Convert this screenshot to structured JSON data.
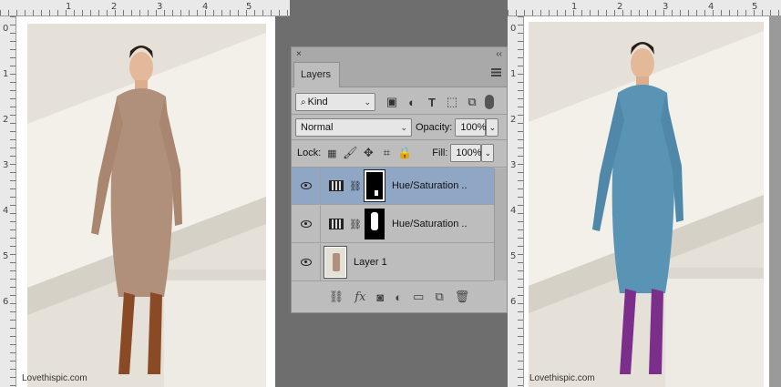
{
  "left_doc": {
    "ruler_numbers": [
      "1",
      "2",
      "3",
      "4",
      "5"
    ],
    "side_numbers": [
      "0",
      "1",
      "2",
      "3",
      "4",
      "5",
      "6"
    ],
    "watermark": "Lovethispic.com",
    "dress_color": "#b0907a",
    "boot_color": "#8a4a25"
  },
  "right_doc": {
    "ruler_numbers": [
      "1",
      "2",
      "3",
      "4",
      "5"
    ],
    "side_numbers": [
      "0",
      "1",
      "2",
      "3",
      "4",
      "5",
      "6"
    ],
    "watermark": "Lovethispic.com",
    "dress_color": "#5a94b5",
    "boot_color": "#7c2f8a"
  },
  "layers_panel": {
    "close_glyph": "×",
    "collapse_glyph": "‹‹",
    "tab_label": "Layers",
    "filter_kind": "Kind",
    "blend_mode": "Normal",
    "opacity_label": "Opacity:",
    "opacity_value": "100%",
    "lock_label": "Lock:",
    "fill_label": "Fill:",
    "fill_value": "100%",
    "layers": [
      {
        "name": "Hue/Saturation ..",
        "selected": true
      },
      {
        "name": "Hue/Saturation ..",
        "selected": false
      },
      {
        "name": "Layer 1",
        "selected": false
      }
    ],
    "bottom_icons": [
      "link-icon",
      "fx-icon",
      "mask-icon",
      "adjustment-icon",
      "folder-icon",
      "new-layer-icon",
      "trash-icon"
    ]
  },
  "colors": {
    "selection": "#8fa7c4",
    "panel_bg": "#bdbdbd"
  }
}
